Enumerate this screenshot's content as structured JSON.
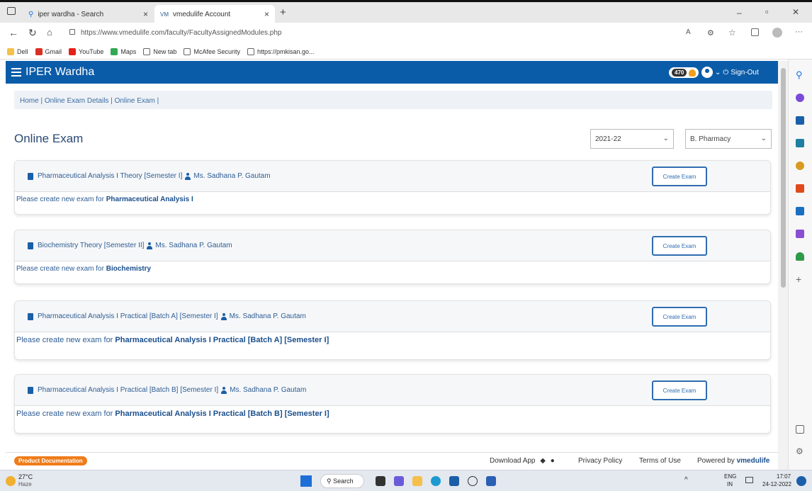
{
  "browser": {
    "tabs": [
      {
        "label": "iper wardha - Search",
        "close": "×"
      },
      {
        "label": "vmedulife Account",
        "close": "×"
      }
    ],
    "new_tab": "+",
    "window_controls": {
      "minimize": "–",
      "restore": "▫",
      "close": "✕"
    },
    "url": "https://www.vmedulife.com/faculty/FacultyAssignedModules.php",
    "bookmarks": [
      "Dell",
      "Gmail",
      "YouTube",
      "Maps",
      "New tab",
      "McAfee Security",
      "https://pmkisan.go..."
    ]
  },
  "app": {
    "brand": "IPER Wardha",
    "coins": "470",
    "signout": "Sign-Out",
    "breadcrumb": "Home | Online Exam Details | Online Exam |",
    "page_title": "Online Exam",
    "year_select": "2021-22",
    "program_select": "B. Pharmacy",
    "create_label": "Create Exam",
    "cards": [
      {
        "subject": "Pharmaceutical Analysis I Theory  [Semester I]",
        "faculty": "Ms. Sadhana P. Gautam",
        "prompt": "Please create new exam for",
        "target": "Pharmaceutical Analysis I"
      },
      {
        "subject": "Biochemistry Theory  [Semester II]",
        "faculty": "Ms. Sadhana P. Gautam",
        "prompt": "Please create new exam for",
        "target": "Biochemistry"
      },
      {
        "subject": "Pharmaceutical Analysis I Practical  [Batch A]  [Semester I]",
        "faculty": "Ms. Sadhana P. Gautam",
        "prompt": "Please create new exam for",
        "target": "Pharmaceutical Analysis I Practical  [Batch A]  [Semester I]"
      },
      {
        "subject": "Pharmaceutical Analysis I Practical  [Batch B]  [Semester I]",
        "faculty": "Ms. Sadhana P. Gautam",
        "prompt": "Please create new exam for",
        "target": "Pharmaceutical Analysis I Practical  [Batch B]  [Semester I]"
      }
    ],
    "footer": {
      "doc_badge": "Product Documentation",
      "download": "Download App",
      "privacy": "Privacy Policy",
      "terms": "Terms of Use",
      "powered_by": "Powered by",
      "powered_brand": "vmedulife"
    }
  },
  "taskbar": {
    "weather_temp": "27°C",
    "weather_desc": "Haze",
    "search": "Search",
    "lang_top": "ENG",
    "lang_bottom": "IN",
    "time": "17:07",
    "date": "24-12-2022"
  },
  "colors": {
    "appbar": "#0b5ca8",
    "link": "#2e5d93",
    "doc_badge": "#f07c19"
  }
}
